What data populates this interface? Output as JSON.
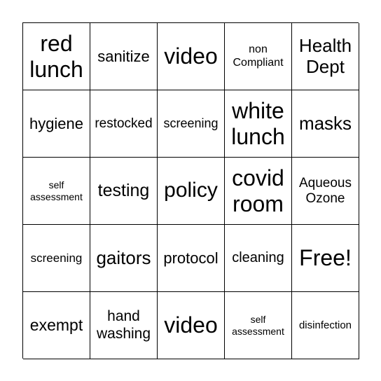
{
  "cells": [
    [
      "red lunch",
      "sanitize",
      "video",
      "non Compliant",
      "Health Dept"
    ],
    [
      "hygiene",
      "restocked",
      "screening",
      "white lunch",
      "masks"
    ],
    [
      "self assessment",
      "testing",
      "policy",
      "covid room",
      "Aqueous Ozone"
    ],
    [
      "screening",
      "gaitors",
      "protocol",
      "cleaning",
      "Free!"
    ],
    [
      "exempt",
      "hand washing",
      "video",
      "self assessment",
      "disinfection"
    ]
  ]
}
